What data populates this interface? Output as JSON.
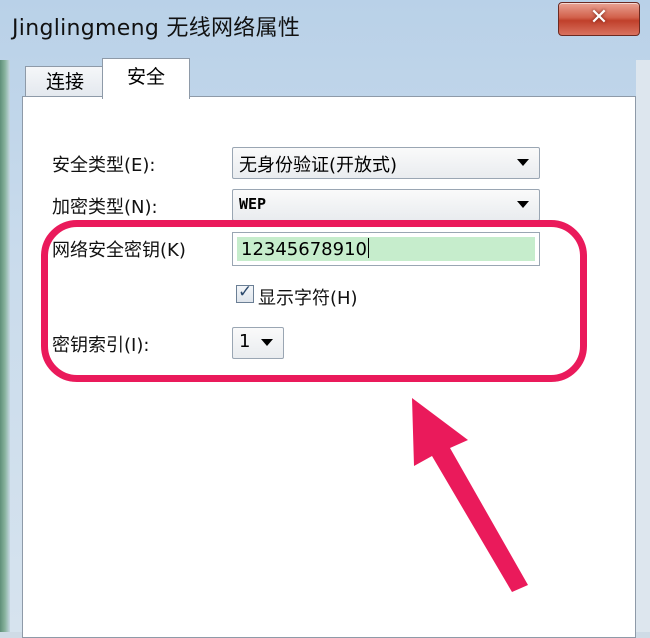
{
  "window": {
    "title": "Jinglingmeng 无线网络属性",
    "close_label": "✕"
  },
  "tabs": {
    "connect": "连接",
    "security": "安全"
  },
  "security": {
    "type_label": "安全类型(E):",
    "type_value": "无身份验证(开放式)",
    "encryption_label": "加密类型(N):",
    "encryption_value": "WEP",
    "key_label": "网络安全密钥(K)",
    "key_value": "12345678910",
    "show_chars_label": "显示字符(H)",
    "show_chars_checked": true,
    "key_index_label": "密钥索引(I):",
    "key_index_value": "1"
  },
  "annotation": {
    "highlight_color": "#ea1a5b"
  },
  "icons": {
    "close": "close-icon",
    "dropdown": "chevron-down-icon",
    "check": "checkmark-icon"
  }
}
